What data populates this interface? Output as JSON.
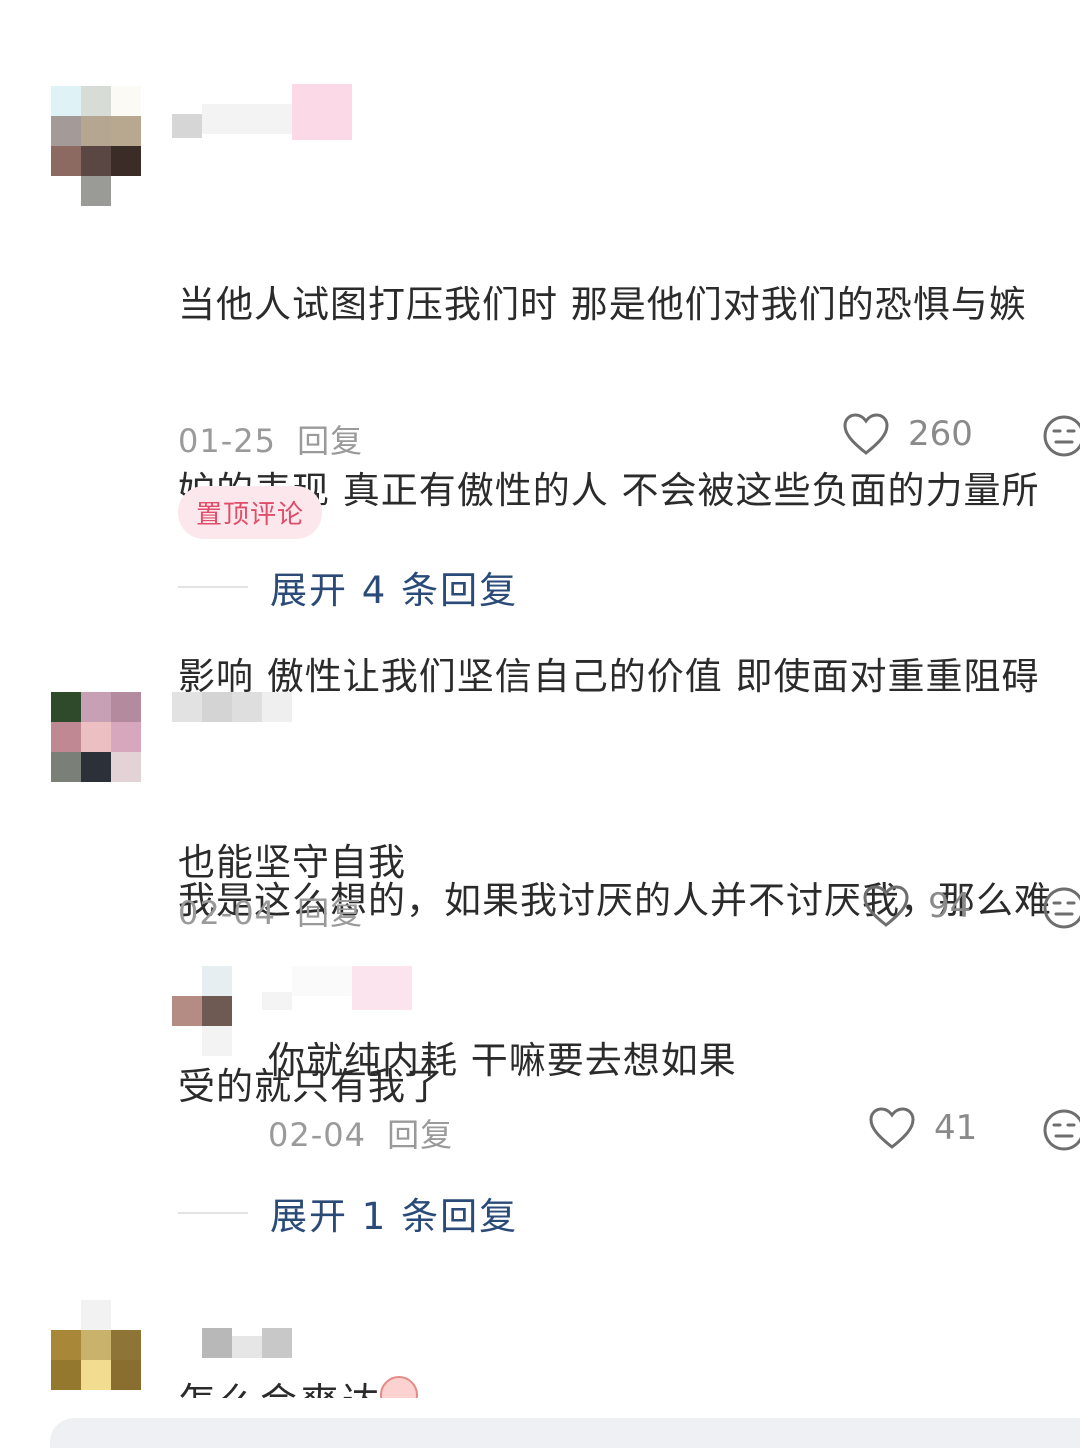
{
  "comments": [
    {
      "text": "当他人试图打压我们时 那是他们对我们的恐惧与嫉妒的表现 真正有傲性的人 不会被这些负面的力量所影响 傲性让我们坚信自己的价值 即使面对重重阻碍也能坚守自我",
      "lines": [
        "当他人试图打压我们时 那是他们对我们的恐惧与嫉",
        "妒的表现 真正有傲性的人 不会被这些负面的力量所",
        "影响 傲性让我们坚信自己的价值 即使面对重重阻碍",
        "也能坚守自我"
      ],
      "date": "01-25",
      "reply_label": "回复",
      "likes": "260",
      "tag": "置顶评论",
      "expand_label": "展开 4 条回复"
    },
    {
      "lines": [
        "我是这么想的，如果我讨厌的人并不讨厌我，那么难",
        "受的就只有我了"
      ],
      "date": "02-04",
      "reply_label": "回复",
      "likes": "94",
      "reply": {
        "text": "你就纯内耗 干嘛要去想如果",
        "date": "02-04",
        "reply_label": "回复",
        "likes": "41"
      },
      "expand_label": "展开 1 条回复"
    },
    {
      "partial_text": "怎么会爽达"
    }
  ],
  "icons": {
    "like": "heart-outline-icon",
    "reaction": "emoji-face-icon"
  },
  "colors": {
    "pin_tag_bg": "#fce8ec",
    "pin_tag_text": "#e04d6a",
    "expand_text": "#2a4a78",
    "meta_text": "#9a9a9a"
  }
}
